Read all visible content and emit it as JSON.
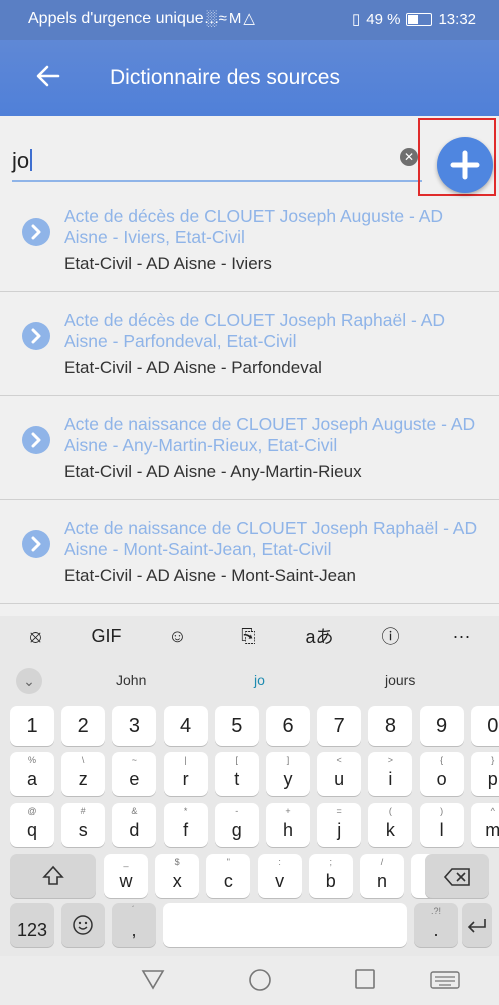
{
  "status_bar": {
    "notification_text": "Appels d'urgence unique…",
    "battery_percent": "49 %",
    "battery_level": 0.49,
    "time": "13:32",
    "icons": [
      "signal-icon",
      "wifi-icon",
      "mail-icon",
      "alert-icon",
      "vibrate-icon",
      "battery-icon"
    ]
  },
  "app_bar": {
    "title": "Dictionnaire des sources",
    "back_icon": "arrow-left-icon"
  },
  "search": {
    "value": "jo",
    "clear_icon": "clear-icon",
    "add_icon": "plus-icon"
  },
  "results": [
    {
      "title": "Acte de décès de CLOUET Joseph Auguste - AD Aisne - Iviers, Etat-Civil",
      "subtitle": "Etat-Civil - AD Aisne - Iviers"
    },
    {
      "title": "Acte de décès de CLOUET Joseph Raphaël - AD Aisne - Parfondeval, Etat-Civil",
      "subtitle": "Etat-Civil - AD Aisne - Parfondeval"
    },
    {
      "title": "Acte de naissance de CLOUET Joseph Auguste - AD Aisne - Any-Martin-Rieux, Etat-Civil",
      "subtitle": "Etat-Civil - AD Aisne - Any-Martin-Rieux"
    },
    {
      "title": "Acte de naissance de CLOUET Joseph Raphaël - AD Aisne - Mont-Saint-Jean, Etat-Civil",
      "subtitle": "Etat-Civil - AD Aisne - Mont-Saint-Jean"
    }
  ],
  "keyboard": {
    "toolbar": [
      {
        "name": "copilot-icon",
        "label": "⦻"
      },
      {
        "name": "gif-icon",
        "label": "GIF"
      },
      {
        "name": "sticker-icon",
        "label": "☺"
      },
      {
        "name": "clipboard-icon",
        "label": "⎘"
      },
      {
        "name": "translate-icon",
        "label": "aあ"
      },
      {
        "name": "info-icon",
        "label": "ⓘ"
      },
      {
        "name": "more-icon",
        "label": "···"
      }
    ],
    "suggestions": [
      "John",
      "jo",
      "jours"
    ],
    "numbers": [
      "1",
      "2",
      "3",
      "4",
      "5",
      "6",
      "7",
      "8",
      "9",
      "0"
    ],
    "row1": [
      {
        "k": "a",
        "h": "%"
      },
      {
        "k": "z",
        "h": "\\"
      },
      {
        "k": "e",
        "h": "~"
      },
      {
        "k": "r",
        "h": "|"
      },
      {
        "k": "t",
        "h": "["
      },
      {
        "k": "y",
        "h": "]"
      },
      {
        "k": "u",
        "h": "<"
      },
      {
        "k": "i",
        "h": ">"
      },
      {
        "k": "o",
        "h": "{"
      },
      {
        "k": "p",
        "h": "}"
      }
    ],
    "row2": [
      {
        "k": "q",
        "h": "@"
      },
      {
        "k": "s",
        "h": "#"
      },
      {
        "k": "d",
        "h": "&"
      },
      {
        "k": "f",
        "h": "*"
      },
      {
        "k": "g",
        "h": "-"
      },
      {
        "k": "h",
        "h": "+"
      },
      {
        "k": "j",
        "h": "="
      },
      {
        "k": "k",
        "h": "("
      },
      {
        "k": "l",
        "h": ")"
      },
      {
        "k": "m",
        "h": "^"
      }
    ],
    "row3": [
      {
        "k": "w",
        "h": "_"
      },
      {
        "k": "x",
        "h": "$"
      },
      {
        "k": "c",
        "h": "\""
      },
      {
        "k": "v",
        "h": ":"
      },
      {
        "k": "b",
        "h": ";"
      },
      {
        "k": "n",
        "h": "/"
      },
      {
        "k": "'",
        "h": ""
      }
    ],
    "num_key": "123",
    "comma": ",",
    "period": ".",
    "comma_hint": "́",
    "period_hint": ".?!"
  }
}
